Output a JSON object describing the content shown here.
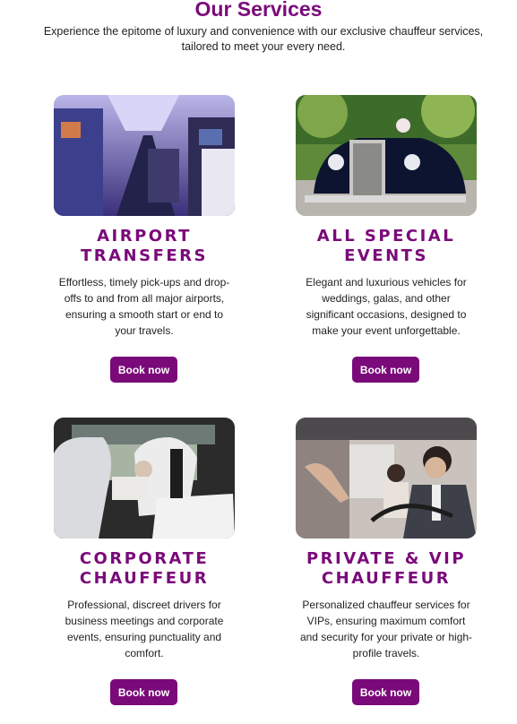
{
  "header": {
    "title": "Our Services",
    "subtitle": "Experience the epitome of luxury and convenience with our exclusive chauffeur services, tailored to meet your every need."
  },
  "services": [
    {
      "title_line1": "AIRPORT",
      "title_line2": "TRANSFERS",
      "description": "Effortless, timely pick-ups and drop-offs to and from all major airports, ensuring a smooth start or end to your travels.",
      "button_label": "Book now"
    },
    {
      "title_line1": "ALL SPECIAL",
      "title_line2": "EVENTS",
      "description": "Elegant and luxurious vehicles for weddings, galas, and other significant occasions, designed to make your event unforgettable.",
      "button_label": "Book now"
    },
    {
      "title_line1": "CORPORATE",
      "title_line2": "CHAUFFEUR",
      "description": "Professional, discreet drivers for business meetings and corporate events, ensuring punctuality and comfort.",
      "button_label": "Book now"
    },
    {
      "title_line1": "PRIVATE & VIP",
      "title_line2": "CHAUFFEUR",
      "description": "Personalized chauffeur services for VIPs, ensuring maximum comfort and security for your private or high-profile travels.",
      "button_label": "Book now"
    }
  ],
  "colors": {
    "accent": "#7a0a7a",
    "button_text": "#ffffff"
  }
}
